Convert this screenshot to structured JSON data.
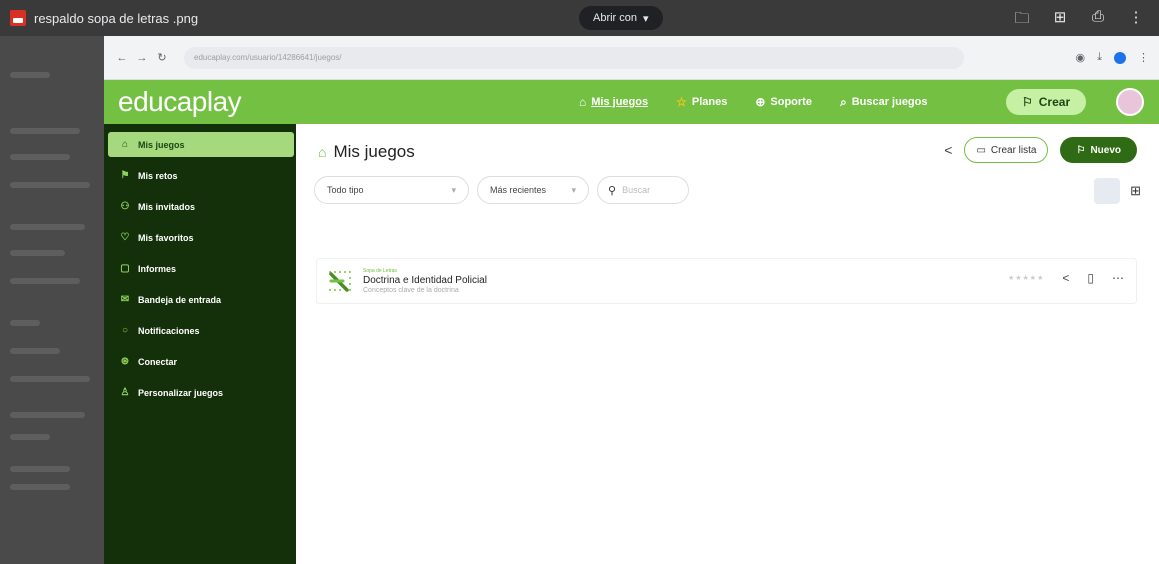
{
  "viewer": {
    "file_title": "respaldo sopa de letras .png",
    "open_with": "Abrir con"
  },
  "browser": {
    "url": "educaplay.com/usuario/14286641/juegos/"
  },
  "header": {
    "logo": "educaplay",
    "nav": [
      {
        "label": "Mis juegos",
        "icon": "home-icon"
      },
      {
        "label": "Planes",
        "icon": "star-icon"
      },
      {
        "label": "Soporte",
        "icon": "help-icon"
      },
      {
        "label": "Buscar juegos",
        "icon": "search-games-icon"
      }
    ],
    "create_label": "Crear"
  },
  "sidebar": {
    "items": [
      {
        "label": "Mis juegos"
      },
      {
        "label": "Mis retos"
      },
      {
        "label": "Mis invitados"
      },
      {
        "label": "Mis favoritos"
      },
      {
        "label": "Informes"
      },
      {
        "label": "Bandeja de entrada"
      },
      {
        "label": "Notificaciones"
      },
      {
        "label": "Conectar"
      },
      {
        "label": "Personalizar juegos"
      }
    ]
  },
  "main": {
    "title": "Mis juegos",
    "create_list_label": "Crear lista",
    "new_label": "Nuevo",
    "filter_type": "Todo tipo",
    "filter_sort": "Más recientes",
    "search_placeholder": "Buscar"
  },
  "games": [
    {
      "type": "Sopa de Letras",
      "name": "Doctrina e Identidad Policial",
      "description": "Conceptos clave de la doctrina"
    }
  ],
  "colors": {
    "brand_green": "#74c043",
    "sidebar_dark": "#14300a",
    "new_button": "#2f6a14"
  }
}
